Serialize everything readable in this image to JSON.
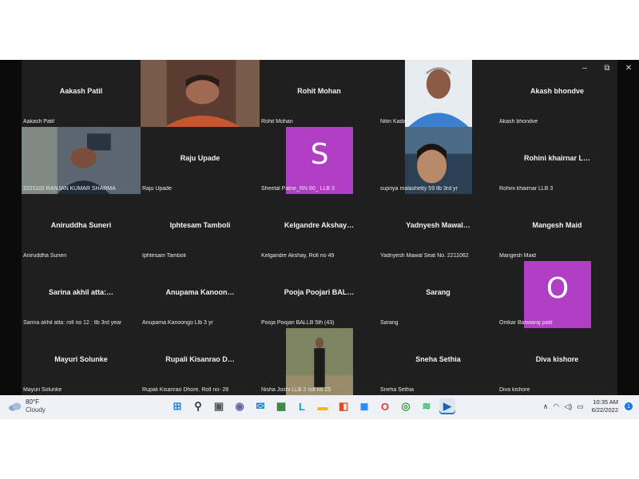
{
  "participants": [
    {
      "id": "p1",
      "display_name": "Aakash Patil",
      "label": "Aakash Patil",
      "type": "name"
    },
    {
      "id": "p2",
      "display_name": "",
      "label": "",
      "type": "video",
      "subject": "woman-with-glasses"
    },
    {
      "id": "p3",
      "display_name": "Rohit Mohan",
      "label": "Rohit Mohan",
      "type": "name"
    },
    {
      "id": "p4",
      "display_name": "",
      "label": "Nitin Kadam",
      "type": "video",
      "subject": "man-blue-shirt"
    },
    {
      "id": "p5",
      "display_name": "Akash bhondve",
      "label": "Akash bhondve",
      "type": "name"
    },
    {
      "id": "p6",
      "display_name": "",
      "label": "2221102 RANJAN KUMAR SHARMA",
      "type": "video",
      "subject": "man-office"
    },
    {
      "id": "p7",
      "display_name": "Raju Upade",
      "label": "Raju Upade",
      "type": "name"
    },
    {
      "id": "p8",
      "display_name": "",
      "label": "Sheetal Patne_RN 80_ LLB 3",
      "type": "avatar",
      "letter": "S"
    },
    {
      "id": "p9",
      "display_name": "",
      "label": "supriya malashetty 59 llb 3rd yr",
      "type": "video",
      "subject": "woman-selfie"
    },
    {
      "id": "p10",
      "display_name": "Rohini khairnar L…",
      "label": "Rohini khairnar LLB 3",
      "type": "name"
    },
    {
      "id": "p11",
      "display_name": "Aniruddha Suneri",
      "label": "Aniruddha Suneri",
      "type": "name"
    },
    {
      "id": "p12",
      "display_name": "Iphtesam Tamboli",
      "label": "Iphtesam Tamboli",
      "type": "name"
    },
    {
      "id": "p13",
      "display_name": "Kelgandre Akshay…",
      "label": "Kelgandre Akshay, Roll no 49",
      "type": "name"
    },
    {
      "id": "p14",
      "display_name": "Yadnyesh Mawal…",
      "label": "Yadnyesh Mawal Seat No. 2211062",
      "type": "name"
    },
    {
      "id": "p15",
      "display_name": "Mangesh Maid",
      "label": "Mangesh Maid",
      "type": "name"
    },
    {
      "id": "p16",
      "display_name": "Sarina akhil atta:…",
      "label": "Sarina akhil atta: roll no 12 : llb 3rd year",
      "type": "name"
    },
    {
      "id": "p17",
      "display_name": "Anupama Kanoon…",
      "label": "Anupama Kanoongo Llb 3 yr",
      "type": "name"
    },
    {
      "id": "p18",
      "display_name": "Pooja Poojari BAL…",
      "label": "Pooja Poojari BALLB 5th (43)",
      "type": "name"
    },
    {
      "id": "p19",
      "display_name": "Sarang",
      "label": "Sarang",
      "type": "name"
    },
    {
      "id": "p20",
      "display_name": "",
      "label": "Omkar Baswaraj patil",
      "type": "avatar",
      "letter": "O"
    },
    {
      "id": "p21",
      "display_name": "Mayuri Solunke",
      "label": "Mayuri Solunke",
      "type": "name"
    },
    {
      "id": "p22",
      "display_name": "Rupali Kisanrao D…",
      "label": "Rupali Kisanrao Dhore. Roll no- 28",
      "type": "name"
    },
    {
      "id": "p23",
      "display_name": "",
      "label": "Nisha Joshi LLB 2 roll no 25",
      "type": "video",
      "subject": "woman-standing"
    },
    {
      "id": "p24",
      "display_name": "Sneha Sethia",
      "label": "Sneha Sethia",
      "type": "name"
    },
    {
      "id": "p25",
      "display_name": "Diva kishore",
      "label": "Diva kishore",
      "type": "name"
    }
  ],
  "window_controls": {
    "minimize": "–",
    "maximize": "⧉",
    "close": "✕"
  },
  "taskbar": {
    "weather": {
      "temp": "80°F",
      "desc": "Cloudy",
      "icon": "cloud-icon"
    },
    "icons": [
      {
        "name": "windows-start-icon",
        "glyph": "⊞",
        "color": "#1e88e5"
      },
      {
        "name": "search-icon",
        "glyph": "⚲",
        "color": "#333333"
      },
      {
        "name": "task-view-icon",
        "glyph": "▣",
        "color": "#555555"
      },
      {
        "name": "teams-chat-icon",
        "glyph": "◉",
        "color": "#6264a7"
      },
      {
        "name": "mail-icon",
        "glyph": "✉",
        "color": "#1976d2"
      },
      {
        "name": "store-icon",
        "glyph": "▦",
        "color": "#2e7d32"
      },
      {
        "name": "l-app-icon",
        "glyph": "L",
        "color": "#0aa2c0"
      },
      {
        "name": "file-explorer-icon",
        "glyph": "▬",
        "color": "#f2b705"
      },
      {
        "name": "office-icon",
        "glyph": "◧",
        "color": "#e64a19"
      },
      {
        "name": "zoom-icon",
        "glyph": "◼",
        "color": "#2d8cff"
      },
      {
        "name": "opera-icon",
        "glyph": "O",
        "color": "#e53935"
      },
      {
        "name": "chrome-icon",
        "glyph": "◎",
        "color": "#43a047"
      },
      {
        "name": "spotify-icon",
        "glyph": "≋",
        "color": "#1db954"
      },
      {
        "name": "media-player-icon",
        "glyph": "▶",
        "color": "#1565c0"
      }
    ],
    "tray": {
      "chevron": "∧",
      "wifi": "◠",
      "volume": "◁)",
      "battery": "▭"
    },
    "clock": {
      "time": "10:35 AM",
      "date": "6/22/2022"
    },
    "notification_count": "1"
  }
}
